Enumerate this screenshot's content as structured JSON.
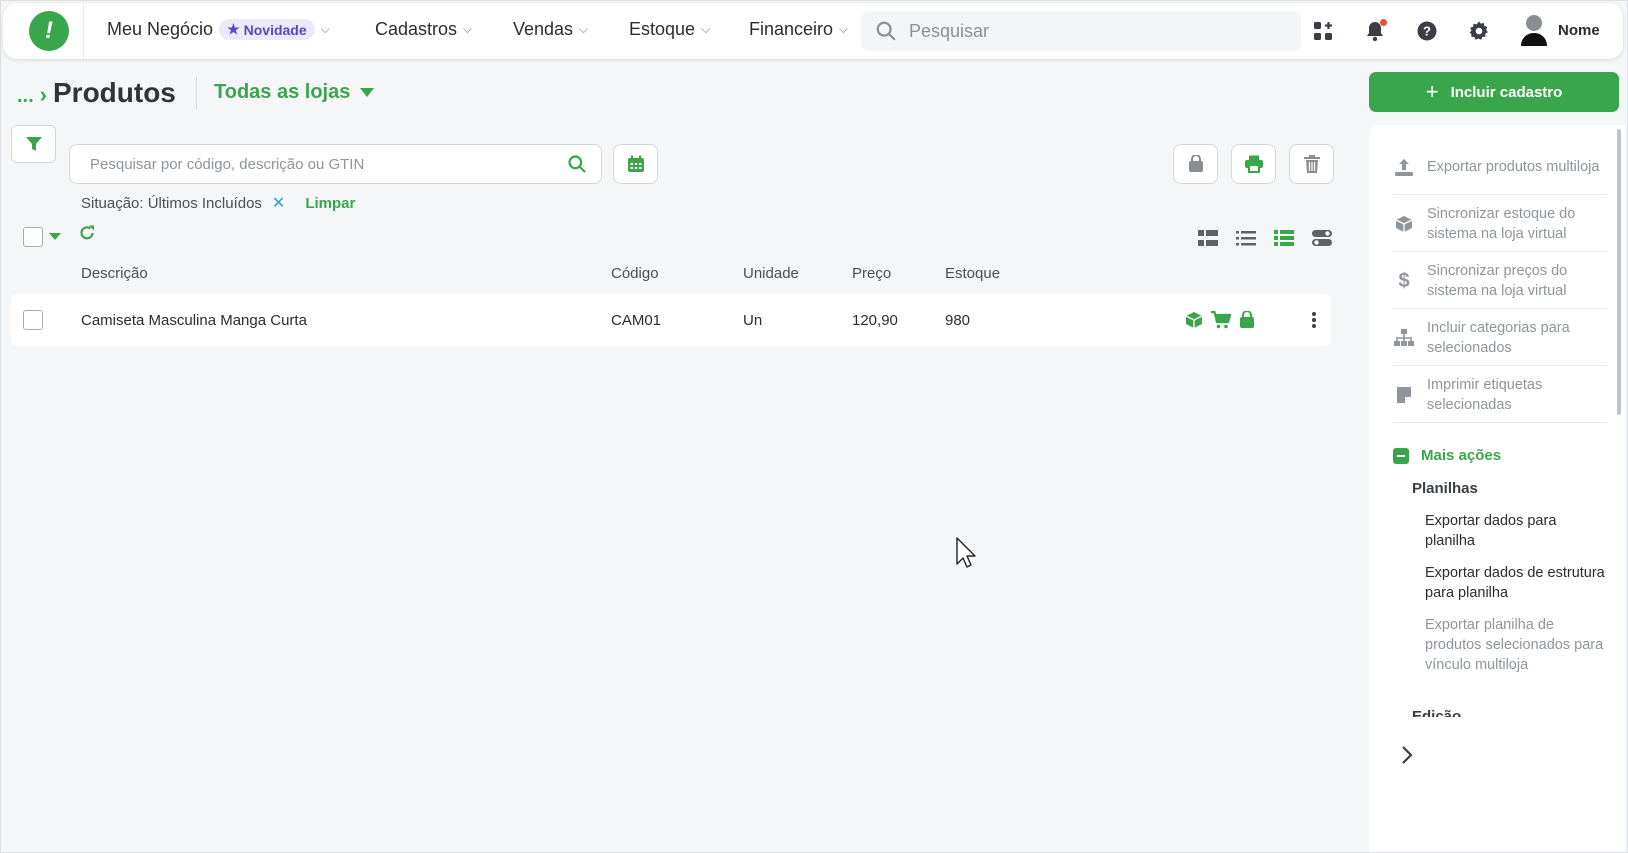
{
  "topbar": {
    "business": "Meu Negócio",
    "badge": "Novidade",
    "nav": [
      "Cadastros",
      "Vendas",
      "Estoque",
      "Financeiro"
    ],
    "search_placeholder": "Pesquisar",
    "user_name": "Nome"
  },
  "header": {
    "breadcrumb_more": "...",
    "title": "Produtos",
    "store_select": "Todas as lojas",
    "include_button": "Incluir cadastro"
  },
  "toolbar": {
    "search_placeholder": "Pesquisar por código, descrição ou GTIN",
    "filter_label": "Situação: Últimos Incluídos",
    "filter_remove": "✕",
    "clear": "Limpar"
  },
  "table": {
    "columns": [
      "Descrição",
      "Código",
      "Unidade",
      "Preço",
      "Estoque"
    ],
    "rows": [
      {
        "descricao": "Camiseta Masculina Manga Curta",
        "codigo": "CAM01",
        "unidade": "Un",
        "preco": "120,90",
        "estoque": "980"
      }
    ]
  },
  "side_panel": {
    "items": [
      "Exportar produtos multiloja",
      "Sincronizar estoque do sistema na loja virtual",
      "Sincronizar preços do sistema na loja virtual",
      "Incluir categorias para selecionados",
      "Imprimir etiquetas selecionadas"
    ],
    "more_actions": "Mais ações",
    "group_planilhas": "Planilhas",
    "planilhas": [
      "Exportar dados para planilha",
      "Exportar dados de estrutura para planilha",
      "Exportar planilha de produtos selecionados para vínculo multiloja"
    ],
    "group_edicao": "Edição"
  },
  "colors": {
    "accent": "#3aa64b",
    "badge": "#5b47c9",
    "link": "#2d9bd1"
  }
}
